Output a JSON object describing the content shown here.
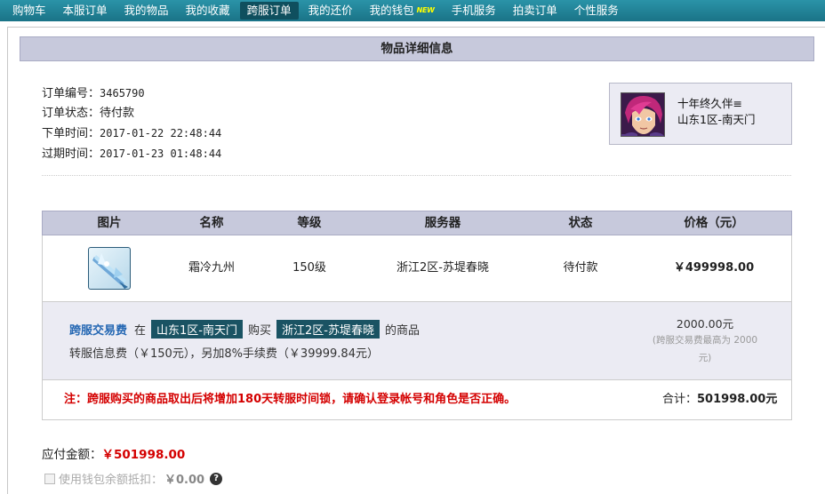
{
  "nav": {
    "items": [
      "购物车",
      "本服订单",
      "我的物品",
      "我的收藏",
      "跨服订单",
      "我的还价",
      "我的钱包",
      "手机服务",
      "拍卖订单",
      "个性服务"
    ],
    "active": "跨服订单",
    "wallet_badge": "NEW"
  },
  "page_title": "物品详细信息",
  "order": {
    "id_label": "订单编号：",
    "id": "3465790",
    "status_label": "订单状态：",
    "status": "待付款",
    "created_label": "下单时间：",
    "created": "2017-01-22 22:48:44",
    "expire_label": "过期时间：",
    "expire": "2017-01-23 01:48:44"
  },
  "role": {
    "name": "十年终久伴≡",
    "server": "山东1区-南天门"
  },
  "table": {
    "headers": [
      "图片",
      "名称",
      "等级",
      "服务器",
      "状态",
      "价格（元）"
    ],
    "row": {
      "name": "霜冷九州",
      "level": "150级",
      "server": "浙江2区-苏堤春晓",
      "status": "待付款",
      "price": "￥499998.00"
    }
  },
  "fee": {
    "link": "跨服交易费",
    "in": "在",
    "from_server": "山东1区-南天门",
    "buy": "购买",
    "to_server": "浙江2区-苏堤春晓",
    "suffix": "的商品",
    "detail": "转服信息费（￥150元），另加8%手续费（￥39999.84元）",
    "amount": "2000.00元",
    "note": "(跨服交易费最高为 2000元)"
  },
  "warning": "注：跨服购买的商品取出后将增加180天转服时间锁，请确认登录帐号和角色是否正确。",
  "total": {
    "label": "合计：",
    "value": "501998.00元"
  },
  "payable": {
    "label": "应付金额：",
    "value": "￥501998.00"
  },
  "wallet_deduct": {
    "label": "使用钱包余额抵扣：",
    "value": "￥0.00",
    "help": "?"
  },
  "colors": {
    "nav": "#1f8499",
    "header": "#c7c9dc",
    "price": "#e0259a",
    "warning": "#d40000",
    "tag": "#1a5363"
  }
}
